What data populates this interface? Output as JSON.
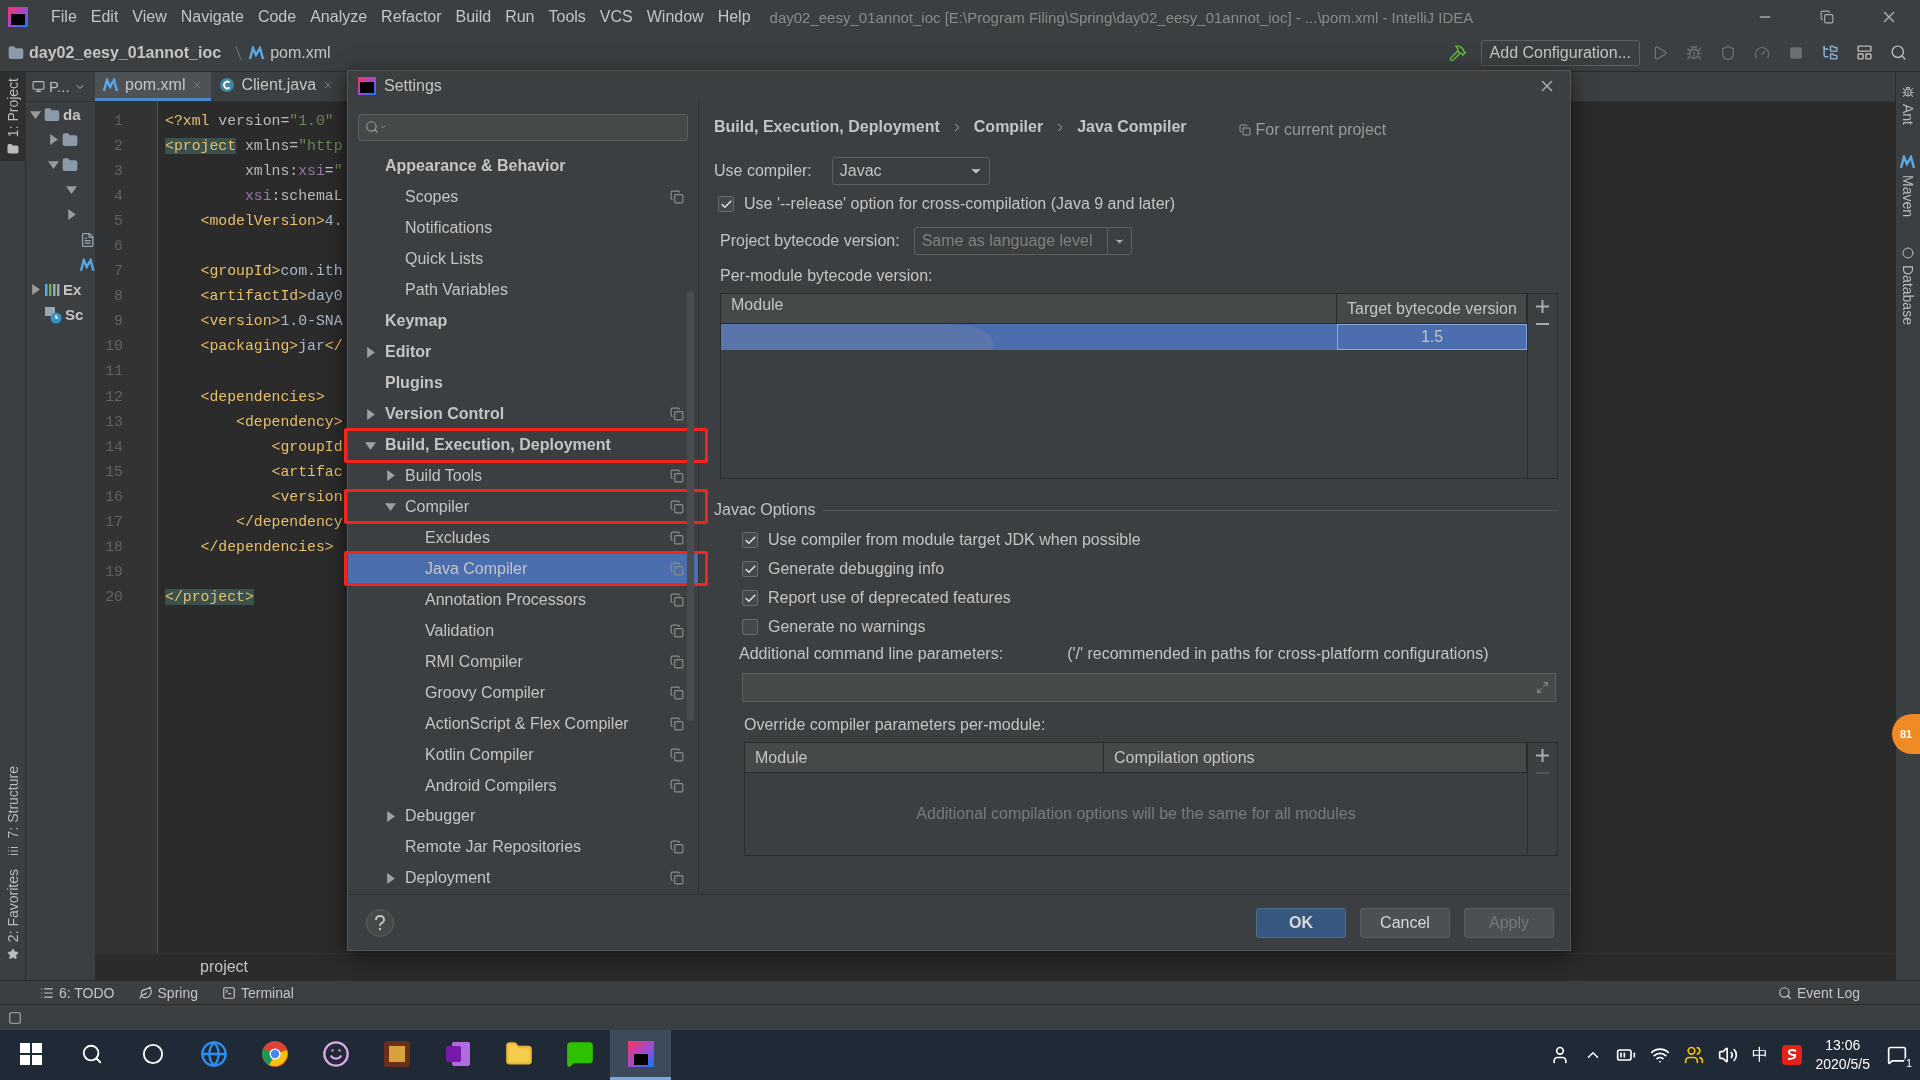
{
  "menu_bar": {
    "items": [
      "File",
      "Edit",
      "View",
      "Navigate",
      "Code",
      "Analyze",
      "Refactor",
      "Build",
      "Run",
      "Tools",
      "VCS",
      "Window",
      "Help"
    ],
    "title": "day02_eesy_01annot_ioc [E:\\Program Filing\\Spring\\day02_eesy_01annot_ioc] - ...\\pom.xml - IntelliJ IDEA"
  },
  "nav_bar": {
    "breadcrumbs": [
      {
        "kind": "folder",
        "label": "day02_eesy_01annot_ioc"
      },
      {
        "kind": "maven",
        "label": "pom.xml"
      }
    ],
    "run_configuration": "Add Configuration..."
  },
  "left_tool_strip": [
    {
      "label": "1: Project",
      "selected": true
    },
    {
      "label": "7: Structure",
      "selected": false
    },
    {
      "label": "2: Favorites",
      "selected": false
    }
  ],
  "right_tool_strip": [
    "Ant",
    "Maven",
    "Database"
  ],
  "project_panel": {
    "title": "P...",
    "tree": [
      {
        "kind": "folder",
        "label": "da",
        "expanded": true,
        "children": [
          {
            "kind": "folder",
            "expanded": false
          },
          {
            "kind": "folder",
            "expanded": true,
            "children": [
              {
                "kind": "node",
                "expanded": true
              },
              {
                "kind": "node",
                "expanded": false
              },
              {
                "kind": "file"
              },
              {
                "kind": "maven"
              }
            ]
          }
        ]
      },
      {
        "kind": "library",
        "label": "Ex",
        "expanded": false
      },
      {
        "kind": "scratch",
        "label": "Sc"
      }
    ]
  },
  "editor": {
    "tabs": [
      {
        "kind": "maven",
        "label": "pom.xml",
        "selected": true
      },
      {
        "kind": "java",
        "label": "Client.java",
        "selected": false
      }
    ],
    "lines": [
      {
        "number": "1",
        "segments": [
          {
            "kind": "tag",
            "text": "<?xml"
          },
          {
            "kind": "attr",
            "text": " version="
          },
          {
            "kind": "value",
            "text": "\"1.0\""
          }
        ]
      },
      {
        "number": "2",
        "segments": [
          {
            "kind": "tag_matched",
            "text": "<project"
          },
          {
            "kind": "attr",
            "text": " xmlns="
          },
          {
            "kind": "value",
            "text": "\"http"
          }
        ]
      },
      {
        "number": "3",
        "segments": [
          {
            "kind": "attr",
            "text": "         xmlns:"
          },
          {
            "kind": "ns",
            "text": "xsi"
          },
          {
            "kind": "attr",
            "text": "="
          },
          {
            "kind": "value",
            "text": "\""
          }
        ]
      },
      {
        "number": "4",
        "segments": [
          {
            "kind": "ns",
            "text": "         xsi"
          },
          {
            "kind": "attr",
            "text": ":schemaL"
          }
        ]
      },
      {
        "number": "5",
        "segments": [
          {
            "kind": "tag",
            "text": "    <modelVersion>"
          },
          {
            "kind": "text",
            "text": "4."
          }
        ]
      },
      {
        "number": "6"
      },
      {
        "number": "7",
        "segments": [
          {
            "kind": "tag",
            "text": "    <groupId>"
          },
          {
            "kind": "text",
            "text": "com.ith"
          }
        ]
      },
      {
        "number": "8",
        "segments": [
          {
            "kind": "tag",
            "text": "    <artifactId>"
          },
          {
            "kind": "text",
            "text": "day0"
          }
        ]
      },
      {
        "number": "9",
        "segments": [
          {
            "kind": "tag",
            "text": "    <version>"
          },
          {
            "kind": "text",
            "text": "1.0-SNA"
          }
        ]
      },
      {
        "number": "10",
        "segments": [
          {
            "kind": "tag",
            "text": "    <packaging>"
          },
          {
            "kind": "text",
            "text": "jar"
          },
          {
            "kind": "tag",
            "text": "</"
          }
        ]
      },
      {
        "number": "11"
      },
      {
        "number": "12",
        "segments": [
          {
            "kind": "tag",
            "text": "    <dependencies>"
          }
        ]
      },
      {
        "number": "13",
        "segments": [
          {
            "kind": "tag",
            "text": "        <dependency>"
          }
        ]
      },
      {
        "number": "14",
        "segments": [
          {
            "kind": "tag",
            "text": "            <groupId"
          }
        ]
      },
      {
        "number": "15",
        "segments": [
          {
            "kind": "tag",
            "text": "            <artifac"
          }
        ]
      },
      {
        "number": "16",
        "segments": [
          {
            "kind": "tag",
            "text": "            <version"
          }
        ]
      },
      {
        "number": "17",
        "segments": [
          {
            "kind": "tag",
            "text": "        </dependency"
          }
        ]
      },
      {
        "number": "18",
        "segments": [
          {
            "kind": "tag",
            "text": "    </dependencies>"
          }
        ]
      },
      {
        "number": "19"
      },
      {
        "number": "20",
        "segments": [
          {
            "kind": "tag_matched",
            "text": "</project>"
          }
        ]
      }
    ],
    "breadcrumb": "project"
  },
  "settings_dialog": {
    "title": "Settings",
    "tree": [
      {
        "label": "Appearance & Behavior",
        "selected": false,
        "highlighted": false,
        "project_scope": false,
        "children": [
          {
            "label": "Scopes",
            "selected": false,
            "highlighted": false,
            "project_scope": true
          },
          {
            "label": "Notifications",
            "selected": false,
            "highlighted": false,
            "project_scope": false
          },
          {
            "label": "Quick Lists",
            "selected": false,
            "highlighted": false,
            "project_scope": false
          },
          {
            "label": "Path Variables",
            "selected": false,
            "highlighted": false,
            "project_scope": false
          }
        ]
      },
      {
        "label": "Keymap",
        "selected": false,
        "highlighted": false,
        "project_scope": false
      },
      {
        "label": "Editor",
        "expanded": false,
        "selected": false,
        "highlighted": false,
        "project_scope": false
      },
      {
        "label": "Plugins",
        "selected": false,
        "highlighted": false,
        "project_scope": false
      },
      {
        "label": "Version Control",
        "expanded": false,
        "selected": false,
        "highlighted": false,
        "project_scope": true
      },
      {
        "label": "Build, Execution, Deployment",
        "expanded": true,
        "selected": false,
        "highlighted": true,
        "project_scope": false,
        "children": [
          {
            "label": "Build Tools",
            "expanded": false,
            "selected": false,
            "highlighted": false,
            "project_scope": true
          },
          {
            "label": "Compiler",
            "expanded": true,
            "selected": false,
            "highlighted": true,
            "project_scope": true,
            "children": [
              {
                "label": "Excludes",
                "selected": false,
                "highlighted": false,
                "project_scope": true
              },
              {
                "label": "Java Compiler",
                "selected": true,
                "highlighted": true,
                "project_scope": true
              },
              {
                "label": "Annotation Processors",
                "selected": false,
                "highlighted": false,
                "project_scope": true
              },
              {
                "label": "Validation",
                "selected": false,
                "highlighted": false,
                "project_scope": true
              },
              {
                "label": "RMI Compiler",
                "selected": false,
                "highlighted": false,
                "project_scope": true
              },
              {
                "label": "Groovy Compiler",
                "selected": false,
                "highlighted": false,
                "project_scope": true
              },
              {
                "label": "ActionScript & Flex Compiler",
                "selected": false,
                "highlighted": false,
                "project_scope": true
              },
              {
                "label": "Kotlin Compiler",
                "selected": false,
                "highlighted": false,
                "project_scope": true
              },
              {
                "label": "Android Compilers",
                "selected": false,
                "highlighted": false,
                "project_scope": true
              }
            ]
          },
          {
            "label": "Debugger",
            "expanded": false,
            "selected": false,
            "highlighted": false,
            "project_scope": false
          },
          {
            "label": "Remote Jar Repositories",
            "selected": false,
            "highlighted": false,
            "project_scope": true
          },
          {
            "label": "Deployment",
            "expanded": false,
            "selected": false,
            "highlighted": false,
            "project_scope": true
          }
        ]
      }
    ],
    "breadcrumb": [
      "Build, Execution, Deployment",
      "Compiler",
      "Java Compiler"
    ],
    "scope_note": "For current project",
    "use_compiler": {
      "label": "Use compiler:",
      "value": "Javac"
    },
    "release_option": {
      "label": "Use '--release' option for cross-compilation (Java 9 and later)",
      "checked": true
    },
    "project_bytecode": {
      "label": "Project bytecode version:",
      "value": "Same as language level",
      "disabled": true
    },
    "per_module": {
      "label": "Per-module bytecode version:",
      "columns": [
        "Module",
        "Target bytecode version"
      ],
      "rows": [
        {
          "target": "1.5",
          "selected": true
        }
      ]
    },
    "javac_options": {
      "title": "Javac Options",
      "checkboxes": [
        {
          "label": "Use compiler from module target JDK when possible",
          "checked": true
        },
        {
          "label": "Generate debugging info",
          "checked": true
        },
        {
          "label": "Report use of deprecated features",
          "checked": true
        },
        {
          "label": "Generate no warnings",
          "checked": false
        }
      ],
      "command_line": {
        "label": "Additional command line parameters:",
        "hint": "('/' recommended in paths for cross-platform configurations)"
      },
      "override": {
        "label": "Override compiler parameters per-module:",
        "columns": [
          "Module",
          "Compilation options"
        ],
        "empty_text": "Additional compilation options will be the same for all modules"
      }
    },
    "buttons": [
      {
        "label": "OK",
        "kind": "default"
      },
      {
        "label": "Cancel",
        "kind": "normal"
      },
      {
        "label": "Apply",
        "kind": "disabled"
      }
    ]
  },
  "side_widget": {
    "text": "81"
  },
  "tool_window_bar": {
    "items": [
      {
        "kind": "todo",
        "label": "6: TODO"
      },
      {
        "kind": "spring",
        "label": "Spring"
      },
      {
        "kind": "terminal",
        "label": "Terminal"
      }
    ],
    "event_log": "Event Log"
  },
  "taskbar": {
    "apps": [
      {
        "kind": "edge",
        "selected": false
      },
      {
        "kind": "chrome",
        "selected": false
      },
      {
        "kind": "owl",
        "selected": false
      },
      {
        "kind": "game",
        "selected": false
      },
      {
        "kind": "onenote",
        "selected": false
      },
      {
        "kind": "explorer",
        "selected": false
      },
      {
        "kind": "wechat",
        "selected": false
      },
      {
        "kind": "intellij",
        "selected": true
      }
    ],
    "tray": {
      "ime": "中",
      "time": "13:06",
      "date": "2020/5/5",
      "notifications": "1"
    }
  }
}
